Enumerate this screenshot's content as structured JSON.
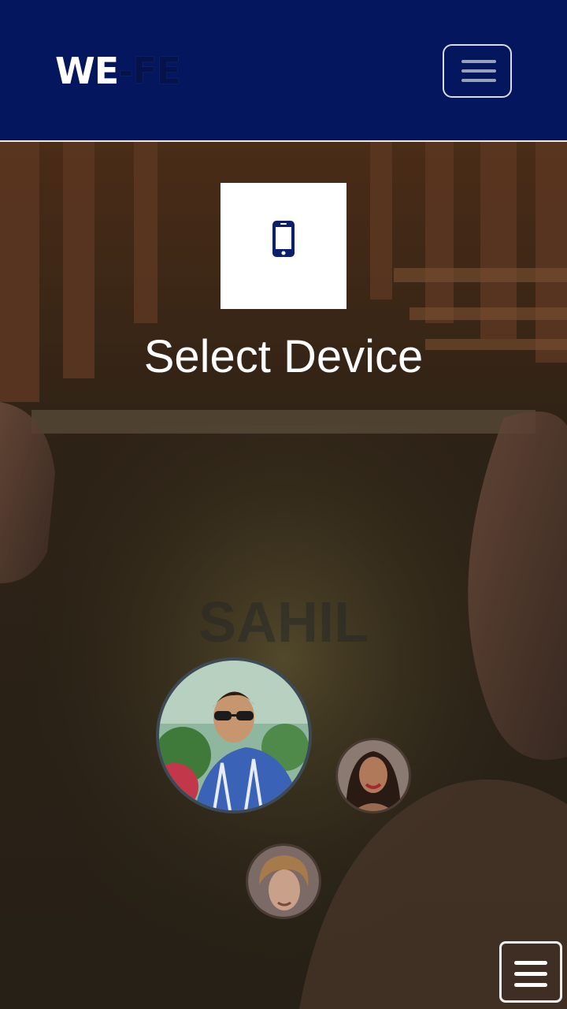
{
  "header": {
    "brand_part1": "WE",
    "brand_part2": "-FE",
    "menu_icon": "hamburger-icon"
  },
  "main": {
    "device_icon": "mobile-phone-icon",
    "title": "Select Device",
    "watermark_name": "SAHIL"
  },
  "avatars": [
    {
      "name": "avatar-user-main",
      "icon": "person-photo"
    },
    {
      "name": "avatar-user-2",
      "icon": "person-photo"
    },
    {
      "name": "avatar-user-3",
      "icon": "person-photo"
    }
  ],
  "floating_menu": {
    "icon": "hamburger-icon"
  },
  "colors": {
    "header_bg": "#03165e",
    "accent": "#03165e",
    "text_on_dark": "#ffffff"
  }
}
